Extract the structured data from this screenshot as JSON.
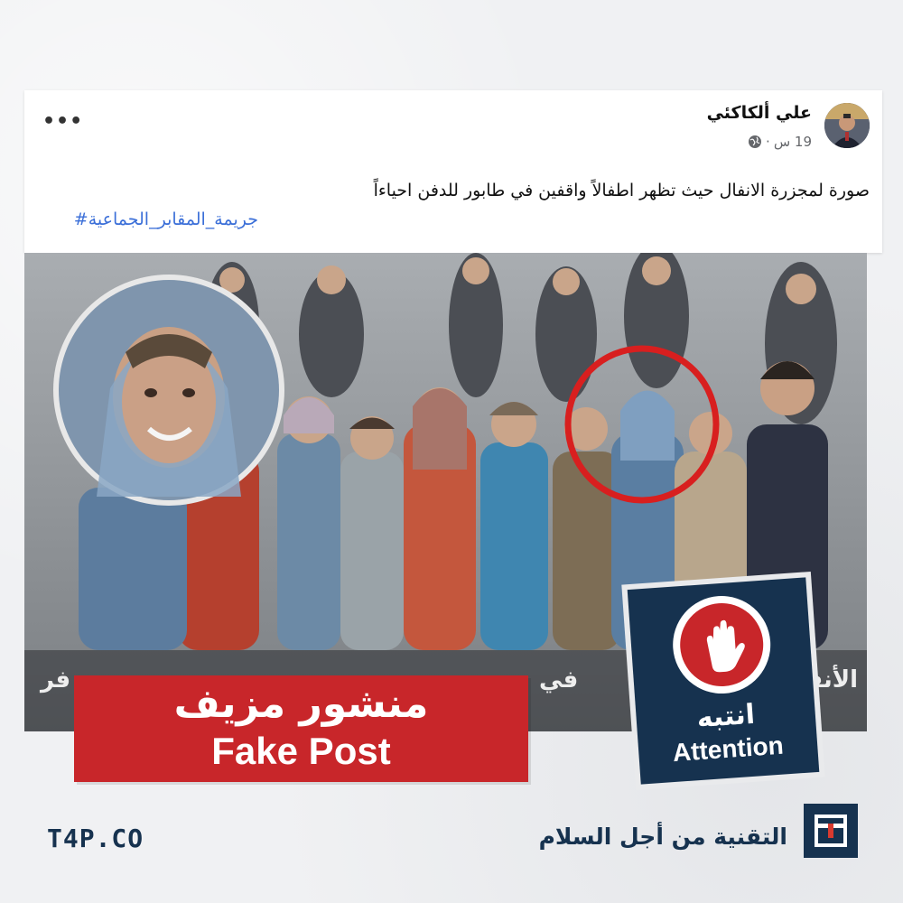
{
  "post": {
    "author": "علي ألكاكئي",
    "time": "19 س",
    "separator": "·",
    "privacy_icon": "globe-icon",
    "more_icon": "more-options-icon",
    "more_label": "•••",
    "text": "صورة لمجزرة الانفال حيث تظهر اطفالاً واقفين في طابور للدفن احياءاً",
    "hashtag": "جريمة_المقابر_الجماعية#"
  },
  "photo": {
    "caption_right": "الأنفال",
    "caption_mid": "في",
    "caption_left": "فر"
  },
  "labels": {
    "fake_ar": "منشور مزيف",
    "fake_en": "Fake Post",
    "attention_ar": "انتبه",
    "attention_en": "Attention",
    "attention_icon": "stop-hand-icon"
  },
  "brand": {
    "site": "T4P.CO",
    "name": "التقنية من أجل السلام",
    "logo_icon": "t4p-logo-icon"
  },
  "colors": {
    "fake_red": "#c8262a",
    "navy": "#16324f",
    "hashtag_blue": "#3b6fd8"
  }
}
